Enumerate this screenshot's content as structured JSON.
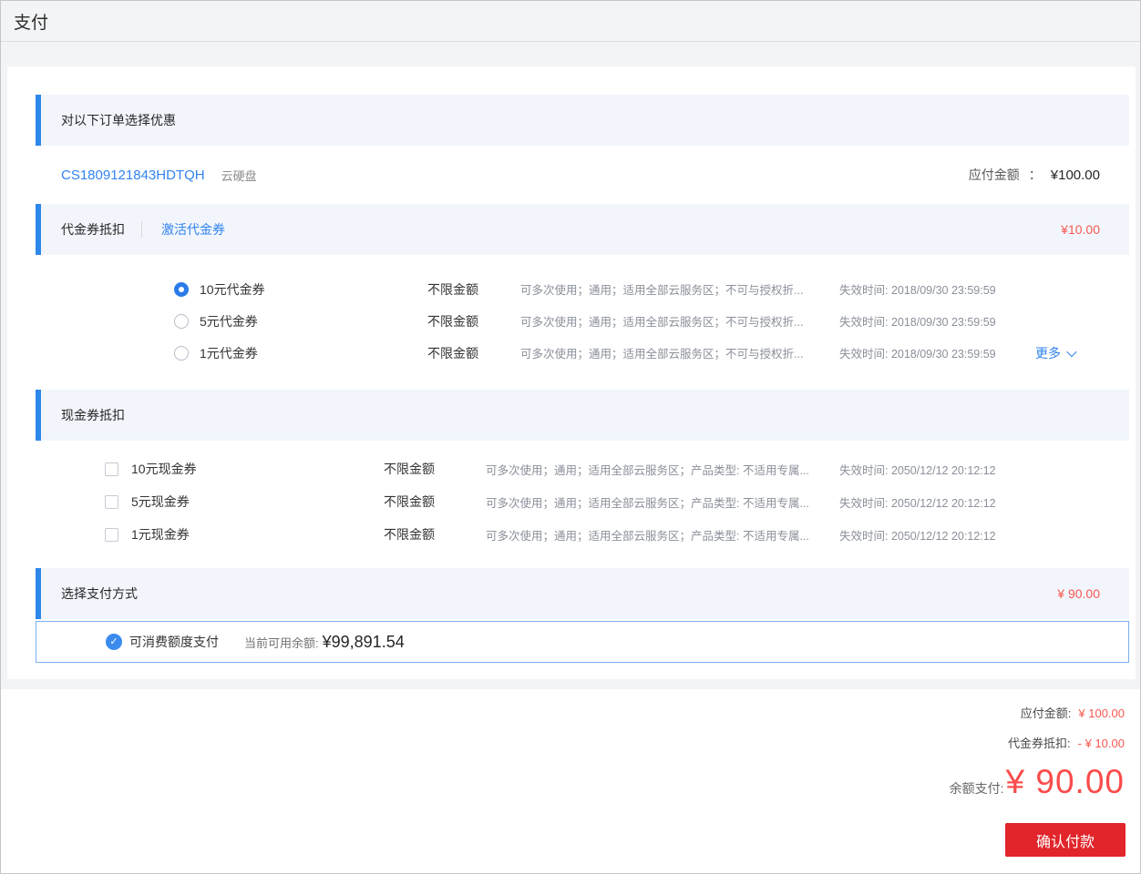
{
  "colors": {
    "accent_blue": "#3183f0",
    "section_bar_blue": "#2e87ea",
    "section_bg": "#f2f6fc",
    "price_red": "#f75851",
    "big_price_red": "#fb4b4b",
    "button_red": "#e1252b",
    "paybox_border_blue": "#79b0f0"
  },
  "header": {
    "title": "支付"
  },
  "order_section": {
    "title": "对以下订单选择优惠",
    "order_id": "CS1809121843HDTQH",
    "product": "云硬盘",
    "amount_label": "应付金额",
    "amount_colon": "：",
    "amount_value": "¥100.00"
  },
  "voucher_section": {
    "title": "代金券抵扣",
    "activate_link": "激活代金券",
    "deduction": "¥10.00",
    "more_label": "更多",
    "rows": [
      {
        "name": "10元代金券",
        "limit": "不限金额",
        "desc": "可多次使用；通用；适用全部云服务区；不可与授权折...",
        "expire": "失效时间: 2018/09/30 23:59:59",
        "selected": true
      },
      {
        "name": "5元代金券",
        "limit": "不限金额",
        "desc": "可多次使用；通用；适用全部云服务区；不可与授权折...",
        "expire": "失效时间: 2018/09/30 23:59:59",
        "selected": false
      },
      {
        "name": "1元代金券",
        "limit": "不限金额",
        "desc": "可多次使用；通用；适用全部云服务区；不可与授权折...",
        "expire": "失效时间: 2018/09/30 23:59:59",
        "selected": false
      }
    ]
  },
  "cash_section": {
    "title": "现金券抵扣",
    "rows": [
      {
        "name": "10元现金券",
        "limit": "不限金额",
        "desc": "可多次使用；通用；适用全部云服务区；产品类型: 不适用专属...",
        "expire": "失效时间: 2050/12/12 20:12:12",
        "checked": false
      },
      {
        "name": "5元现金券",
        "limit": "不限金额",
        "desc": "可多次使用；通用；适用全部云服务区；产品类型: 不适用专属...",
        "expire": "失效时间: 2050/12/12 20:12:12",
        "checked": false
      },
      {
        "name": "1元现金券",
        "limit": "不限金额",
        "desc": "可多次使用；通用；适用全部云服务区；产品类型: 不适用专属...",
        "expire": "失效时间: 2050/12/12 20:12:12",
        "checked": false
      }
    ]
  },
  "payment_section": {
    "title": "选择支付方式",
    "amount": "¥ 90.00",
    "method_name": "可消费额度支付",
    "method_selected": true,
    "balance_label": "当前可用余额:",
    "balance_value": "¥99,891.54",
    "check_icon_glyph": "✓"
  },
  "summary": {
    "due_label": "应付金额:",
    "due_value": "¥ 100.00",
    "voucher_label": "代金券抵扣:",
    "voucher_value": "- ¥ 10.00",
    "pay_label": "余额支付:",
    "pay_value": "¥ 90.00",
    "confirm_label": "确认付款"
  }
}
